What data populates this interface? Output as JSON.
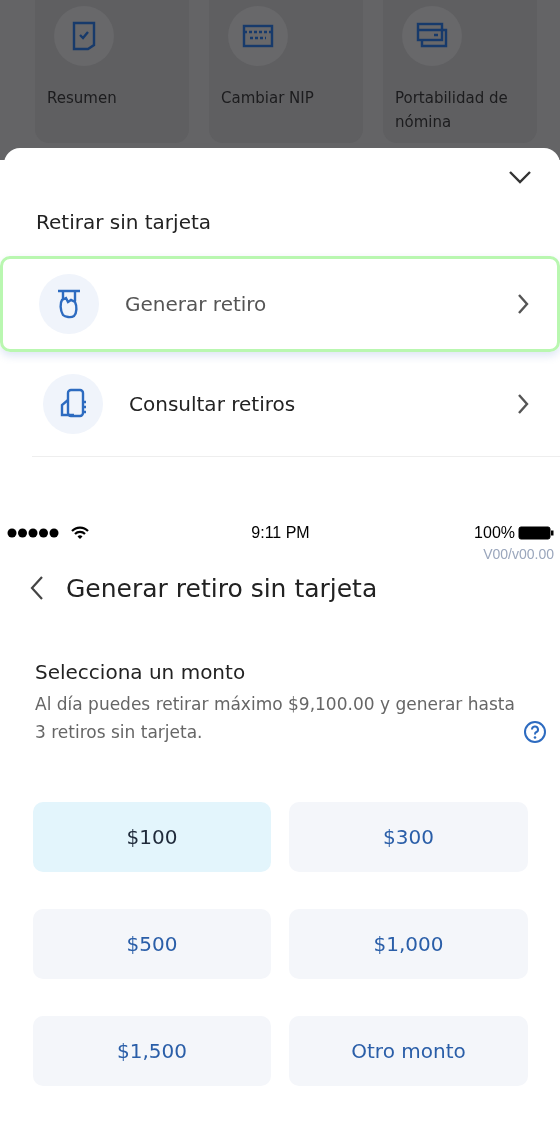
{
  "background_menu": {
    "items": [
      {
        "label": "Resumen",
        "kind": "document"
      },
      {
        "label": "Cambiar NIP",
        "kind": "card"
      },
      {
        "label": "Portabilidad de nómina",
        "kind": "cards"
      }
    ]
  },
  "sheet": {
    "title": "Retirar sin tarjeta",
    "options": [
      {
        "label": "Generar retiro",
        "kind": "withdraw",
        "selected": true
      },
      {
        "label": "Consultar retiros",
        "kind": "query",
        "selected": false
      }
    ]
  },
  "status_bar": {
    "time": "9:11 PM",
    "battery": "100%"
  },
  "version": "V00/v00.00",
  "header": {
    "title": "Generar retiro sin tarjeta"
  },
  "section": {
    "title": "Selecciona un monto",
    "description": "Al día puedes retirar máximo $9,100.00 y generar hasta 3 retiros sin tarjeta."
  },
  "amounts": [
    {
      "label": "$100",
      "selected": true
    },
    {
      "label": "$300",
      "selected": false
    },
    {
      "label": "$500",
      "selected": false
    },
    {
      "label": "$1,000",
      "selected": false
    },
    {
      "label": "$1,500",
      "selected": false
    },
    {
      "label": "Otro monto",
      "selected": false
    }
  ]
}
